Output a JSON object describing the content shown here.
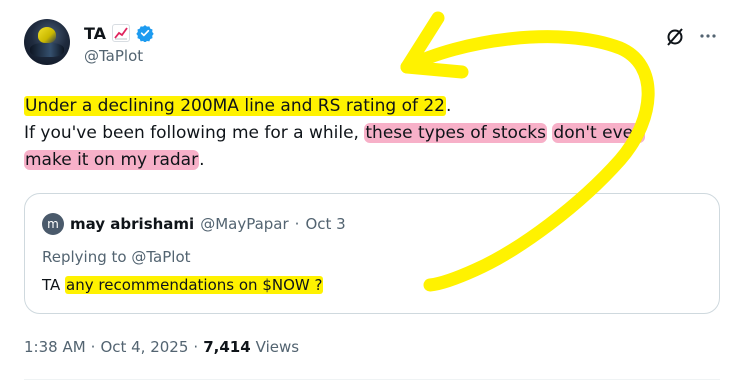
{
  "author": {
    "display_name": "TA",
    "handle": "@TaPlot",
    "emoji_icon": "chart-increasing-icon",
    "verified_color": "#1d9bf0"
  },
  "tweet": {
    "part1_highlighted": "Under a declining 200MA line and RS rating of 22",
    "part1_tail": ".",
    "line2_plain": "If you've been following me for a while, ",
    "line2_highlight_a": "these types of stocks",
    "line2_space": " ",
    "line2_highlight_b": "don't even",
    "line3_highlight": "make it on my radar",
    "line3_tail": "."
  },
  "quote": {
    "avatar_letter": "m",
    "name": "may abrishami",
    "handle": "@MayPapar",
    "separator": "·",
    "date": "Oct 3",
    "replying_to_label": "Replying to",
    "replying_to_handle": "@TaPlot",
    "text_prefix": "TA",
    "text_highlight": "any recommendations on $NOW ?"
  },
  "footer": {
    "time": "1:38 AM",
    "sep1": "·",
    "date": "Oct 4, 2025",
    "sep2": "·",
    "views_count": "7,414",
    "views_label": "Views"
  },
  "colors": {
    "highlight_yellow": "#fff200",
    "highlight_pink": "#f7b0c8",
    "secondary_text": "#536471",
    "border": "#cfd9de"
  }
}
